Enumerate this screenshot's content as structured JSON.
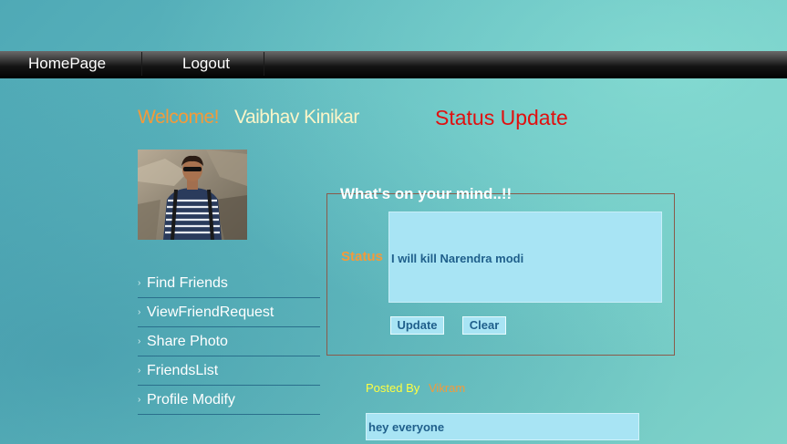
{
  "nav": {
    "home_label": "HomePage",
    "logout_label": "Logout"
  },
  "welcome": {
    "label": "Welcome!",
    "username": "Vaibhav Kinikar"
  },
  "status_heading": "Status Update",
  "menu": {
    "items": [
      {
        "label": "Find Friends"
      },
      {
        "label": "ViewFriendRequest"
      },
      {
        "label": "Share Photo"
      },
      {
        "label": "FriendsList"
      },
      {
        "label": "Profile Modify"
      }
    ]
  },
  "status_form": {
    "legend": "What's on your mind..!!",
    "field_label": "Status",
    "field_value": "I will kill Narendra modi",
    "update_label": "Update",
    "clear_label": "Clear"
  },
  "post": {
    "posted_by_label": "Posted By",
    "author": "Vikram",
    "text": "hey everyone"
  },
  "colors": {
    "accent_orange": "#f39a3a",
    "heading_red": "#e01010",
    "input_bg": "#a8e4f4",
    "input_text": "#1f5f8b"
  }
}
